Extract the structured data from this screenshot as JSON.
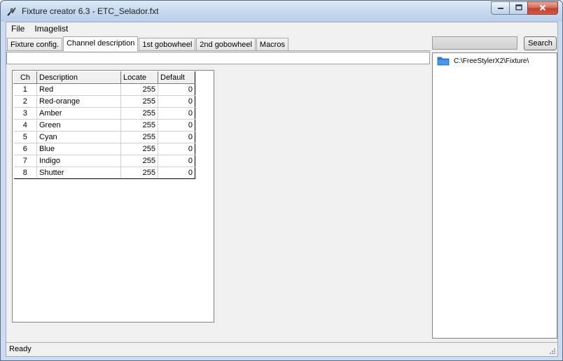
{
  "window": {
    "title": "Fixture creator 6.3 - ETC_Selador.fxt",
    "caption_buttons": {
      "minimize_icon": "minimize-icon",
      "maximize_icon": "maximize-icon",
      "close_icon": "close-icon"
    }
  },
  "menu": {
    "items": [
      "File",
      "Imagelist"
    ]
  },
  "tabs": [
    {
      "label": "Fixture config.",
      "active": false
    },
    {
      "label": "Channel description",
      "active": true
    },
    {
      "label": "1st gobowheel",
      "active": false
    },
    {
      "label": "2nd gobowheel",
      "active": false
    },
    {
      "label": "Macros",
      "active": false
    }
  ],
  "description_field": {
    "value": ""
  },
  "grid": {
    "columns": [
      "Ch",
      "Description",
      "Locate",
      "Default"
    ],
    "rows": [
      {
        "ch": "1",
        "description": "Red",
        "locate": "255",
        "default": "0"
      },
      {
        "ch": "2",
        "description": "Red-orange",
        "locate": "255",
        "default": "0"
      },
      {
        "ch": "3",
        "description": "Amber",
        "locate": "255",
        "default": "0"
      },
      {
        "ch": "4",
        "description": "Green",
        "locate": "255",
        "default": "0"
      },
      {
        "ch": "5",
        "description": "Cyan",
        "locate": "255",
        "default": "0"
      },
      {
        "ch": "6",
        "description": "Blue",
        "locate": "255",
        "default": "0"
      },
      {
        "ch": "7",
        "description": "Indigo",
        "locate": "255",
        "default": "0"
      },
      {
        "ch": "8",
        "description": "Shutter",
        "locate": "255",
        "default": "0"
      }
    ]
  },
  "search": {
    "value": "",
    "button_label": "Search"
  },
  "tree": {
    "items": [
      {
        "label": "C:\\FreeStylerX2\\Fixture\\",
        "icon": "folder-icon",
        "color": "#2f7fd8"
      }
    ]
  },
  "status": {
    "text": "Ready"
  }
}
